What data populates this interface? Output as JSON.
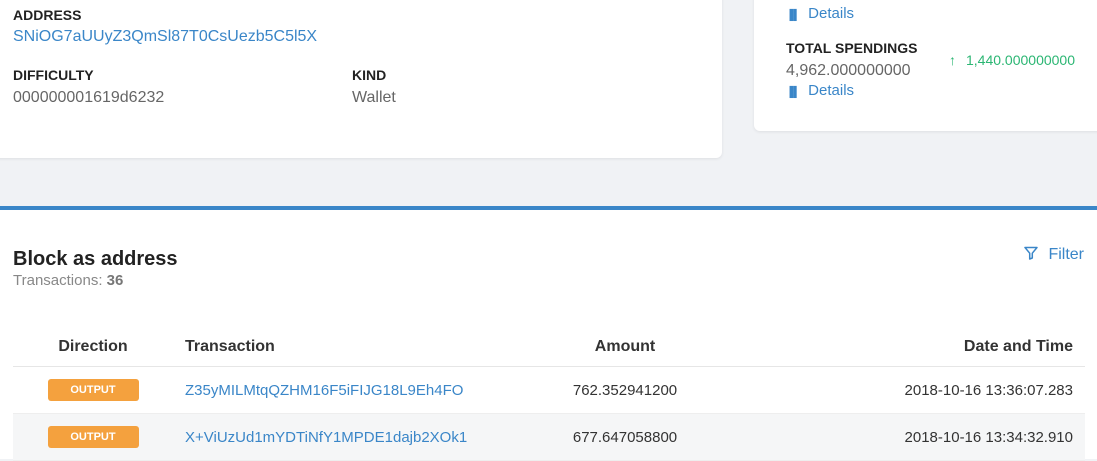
{
  "info_card": {
    "address_label": "ADDRESS",
    "address_value": "SNiOG7aUUyZ3QmSl87T0CsUezb5C5l5X",
    "difficulty_label": "DIFFICULTY",
    "difficulty_value": "000000001619d6232",
    "kind_label": "KIND",
    "kind_value": "Wallet"
  },
  "stats_card": {
    "details_label": "Details",
    "total_spendings_label": "TOTAL SPENDINGS",
    "total_spendings_value": "4,962.000000000",
    "total_spendings_delta": "1,440.000000000",
    "delta_icon": "arrow-up-icon",
    "details_icon": "bar-chart-icon"
  },
  "transactions": {
    "title": "Block as address",
    "count_label": "Transactions:",
    "count_value": "36",
    "filter_label": "Filter",
    "filter_icon": "funnel-icon",
    "columns": [
      "Direction",
      "Transaction",
      "Amount",
      "Date and Time"
    ],
    "rows": [
      {
        "direction": "OUTPUT",
        "tx": "Z35yMILMtqQZHM16F5iFIJG18L9Eh4FO",
        "amount": "762.352941200",
        "datetime": "2018-10-16 13:36:07.283"
      },
      {
        "direction": "OUTPUT",
        "tx": "X+ViUzUd1mYDTiNfY1MPDE1dajb2XOk1",
        "amount": "677.647058800",
        "datetime": "2018-10-16 13:34:32.910"
      }
    ]
  },
  "colors": {
    "accent": "#3a86c8",
    "badge": "#f4a13e",
    "positive": "#2bb673"
  }
}
